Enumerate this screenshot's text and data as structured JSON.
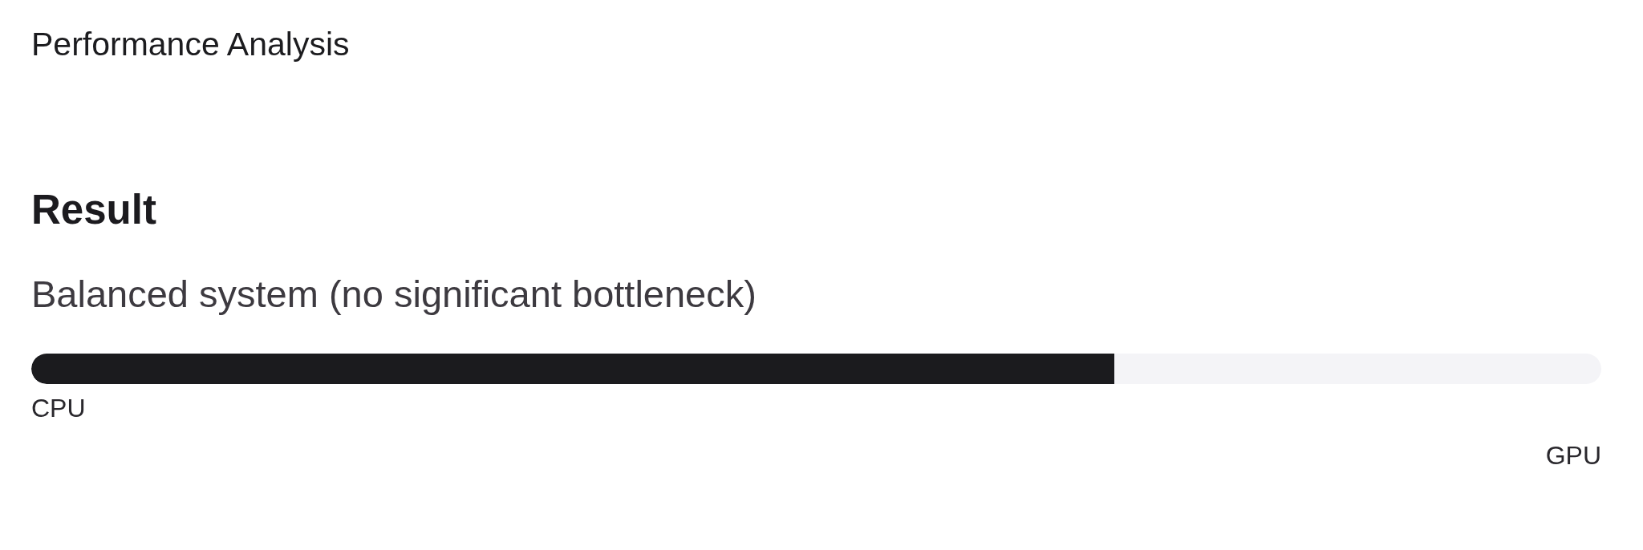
{
  "header": {
    "title": "Performance Analysis"
  },
  "result": {
    "heading": "Result",
    "summary": "Balanced system (no significant bottleneck)",
    "balance": {
      "level": 0.69,
      "start_label": "CPU",
      "end_label": "GPU"
    }
  }
}
